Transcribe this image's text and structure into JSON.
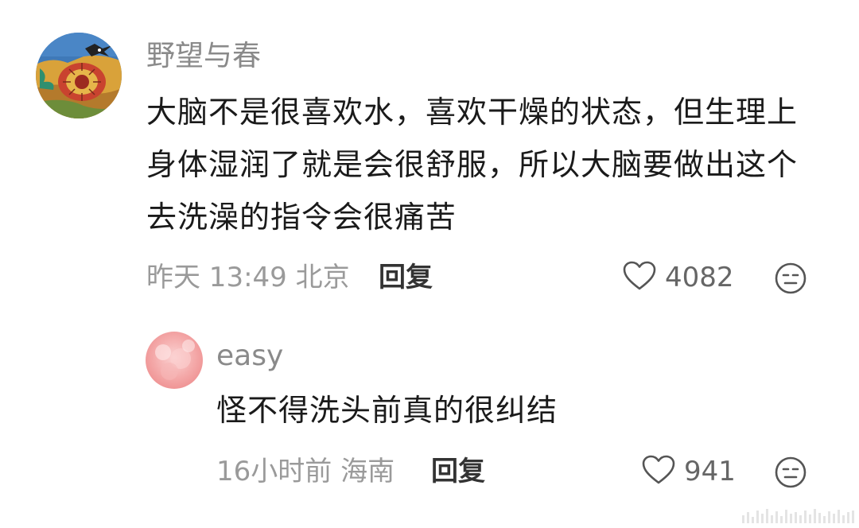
{
  "comments": [
    {
      "username": "野望与春",
      "text": "大脑不是很喜欢水，喜欢干燥的状态，但生理上身体湿润了就是会很舒服，所以大脑要做出这个去洗澡的指令会很痛苦",
      "time_location": "昨天 13:49 北京",
      "reply_label": "回复",
      "likes": "4082",
      "icons": {
        "like": "heart-outline-icon",
        "emoji": "speechless-face-icon"
      }
    },
    {
      "username": "easy",
      "text": "怪不得洗头前真的很纠结",
      "time_location": "16小时前 海南",
      "reply_label": "回复",
      "likes": "941",
      "icons": {
        "like": "heart-outline-icon",
        "emoji": "speechless-face-icon"
      }
    }
  ],
  "colors": {
    "username": "#8a8a8a",
    "text": "#1a1a1a",
    "meta": "#9a9a9a",
    "reply": "#333333",
    "icon": "#555555"
  }
}
